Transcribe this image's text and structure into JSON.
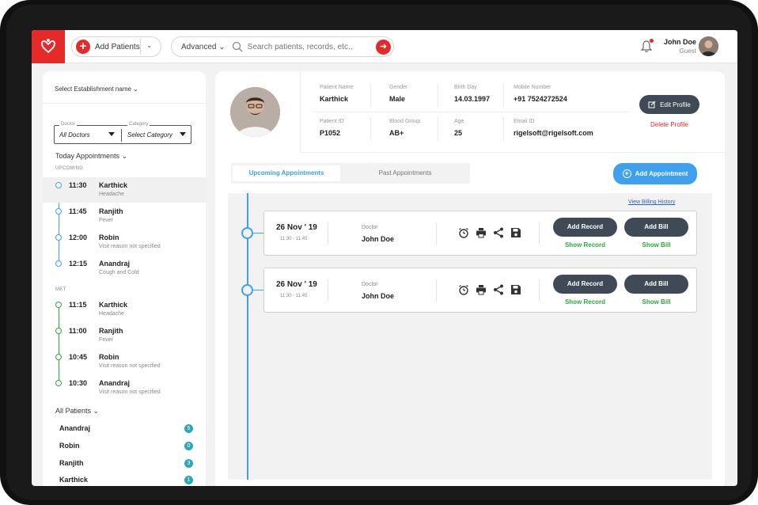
{
  "header": {
    "add_patients_label": "Add Patients",
    "advanced_label": "Advanced",
    "search_placeholder": "Search patients, records, etc.,",
    "user_name": "John Doe",
    "user_role": "Guest",
    "brand_color": "#e62a2a"
  },
  "sidebar": {
    "establishment_label": "Select Establishment name",
    "doctor_legend": "Doctor",
    "doctor_value": "All Doctors",
    "category_legend": "Category",
    "category_value": "Select Category",
    "today_label": "Today Appointments",
    "upcoming_label": "UPCOMING",
    "upcoming": [
      {
        "time": "11:30",
        "name": "Karthick",
        "reason": "Headache"
      },
      {
        "time": "11:45",
        "name": "Ranjith",
        "reason": "Fever"
      },
      {
        "time": "12:00",
        "name": "Robin",
        "reason": "Visit reason not specified"
      },
      {
        "time": "12:15",
        "name": "Anandraj",
        "reason": "Cough and Cold"
      }
    ],
    "met_label": "MET",
    "met": [
      {
        "time": "11:15",
        "name": "Karthick",
        "reason": "Headache"
      },
      {
        "time": "11:00",
        "name": "Ranjith",
        "reason": "Fever"
      },
      {
        "time": "10:45",
        "name": "Robin",
        "reason": "Visit reason not specified"
      },
      {
        "time": "10:30",
        "name": "Anandraj",
        "reason": "Visit reason not specified"
      }
    ],
    "all_patients_label": "All Patients",
    "patients": [
      {
        "name": "Anandraj",
        "count": "5"
      },
      {
        "name": "Robin",
        "count": "0"
      },
      {
        "name": "Ranjith",
        "count": "3"
      },
      {
        "name": "Karthick",
        "count": "1"
      }
    ]
  },
  "profile": {
    "name_label": "Patient Name",
    "name": "Karthick",
    "gender_label": "Gender",
    "gender": "Male",
    "birth_label": "Birth Day",
    "birth": "14.03.1997",
    "mobile_label": "Mobile Number",
    "mobile": "+91 7524272524",
    "id_label": "Patient ID",
    "id": "P1052",
    "blood_label": "Blood Group",
    "blood": "AB+",
    "age_label": "Age",
    "age": "25",
    "email_label": "Email ID",
    "email": "rigelsoft@rigelsoft.com",
    "edit_label": "Edit Profile",
    "delete_label": "Delete Profile"
  },
  "tabs": {
    "upcoming": "Upcoming Appointments",
    "past": "Past Appointments"
  },
  "add_appointment_label": "Add Appointment",
  "billing_history_label": "View Billing History",
  "appointments": [
    {
      "date": "26 Nov ' 19",
      "range": "11:30 - 11:45",
      "doctor_label": "Doctor",
      "doctor": "John Doe",
      "add_record": "Add Record",
      "add_bill": "Add Bill",
      "show_record": "Show Record",
      "show_bill": "Show Bill"
    },
    {
      "date": "26 Nov ' 19",
      "range": "11:30 - 11:45",
      "doctor_label": "Doctor",
      "doctor": "John Doe",
      "add_record": "Add Record",
      "add_bill": "Add Bill",
      "show_record": "Show Record",
      "show_bill": "Show Bill"
    }
  ],
  "icons": [
    "hand-heart-logo-icon",
    "plus-icon",
    "chevron-down-icon",
    "search-icon",
    "arrow-right-icon",
    "bell-icon",
    "alarm-icon",
    "printer-icon",
    "share-icon",
    "save-icon",
    "edit-icon"
  ]
}
